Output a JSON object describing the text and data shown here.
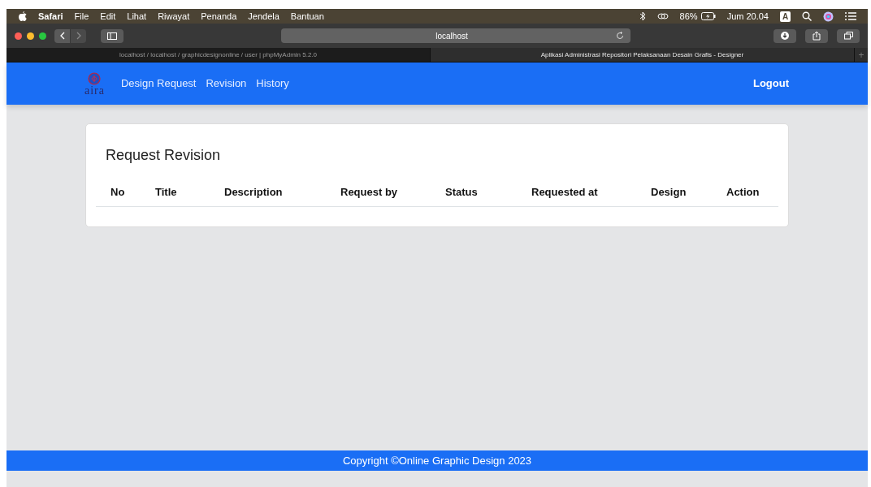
{
  "menu_bar": {
    "app": "Safari",
    "items": [
      "File",
      "Edit",
      "Lihat",
      "Riwayat",
      "Penanda",
      "Jendela",
      "Bantuan"
    ],
    "battery": "86%",
    "clock": "Jum 20.04",
    "input_source": "A"
  },
  "browser": {
    "address": "localhost",
    "tabs": [
      {
        "title": "localhost / localhost / graphicdesignonline / user | phpMyAdmin 5.2.0",
        "selected": false
      },
      {
        "title": "Aplikasi Administrasi Repositori Pelaksanaan Desain Grafis - Designer",
        "selected": true
      }
    ],
    "new_tab": "+"
  },
  "navbar": {
    "brand": "aira",
    "links": [
      "Design Request",
      "Revision",
      "History"
    ],
    "logout": "Logout"
  },
  "card": {
    "title": "Request Revision",
    "table": {
      "columns": [
        "No",
        "Title",
        "Description",
        "Request by",
        "Status",
        "Requested at",
        "Design",
        "Action"
      ]
    }
  },
  "footer": "Copyright ©Online Graphic Design 2023"
}
